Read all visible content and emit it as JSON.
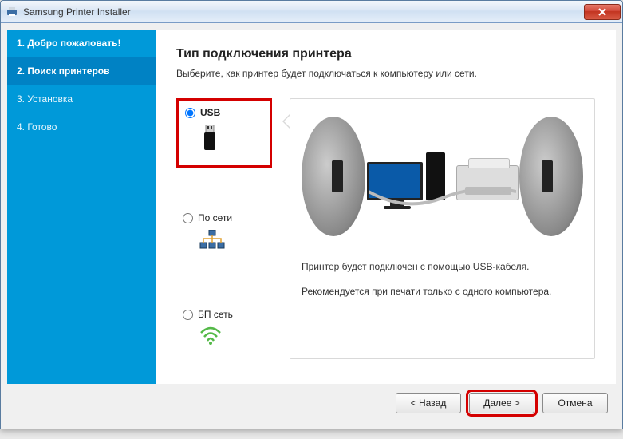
{
  "window": {
    "title": "Samsung Printer Installer"
  },
  "sidebar": {
    "steps": [
      {
        "label": "1. Добро пожаловать!"
      },
      {
        "label": "2. Поиск принтеров"
      },
      {
        "label": "3. Установка"
      },
      {
        "label": "4. Готово"
      }
    ]
  },
  "main": {
    "heading": "Тип подключения принтера",
    "subheading": "Выберите, как принтер будет подключаться к компьютеру или сети.",
    "options": [
      {
        "label": "USB",
        "selected": true
      },
      {
        "label": "По сети",
        "selected": false
      },
      {
        "label": "БП сеть",
        "selected": false
      }
    ],
    "preview": {
      "line1": "Принтер будет подключен с помощью USB-кабеля.",
      "line2": "Рекомендуется при печати только с одного компьютера."
    }
  },
  "footer": {
    "back": "< Назад",
    "next": "Далее >",
    "cancel": "Отмена"
  }
}
